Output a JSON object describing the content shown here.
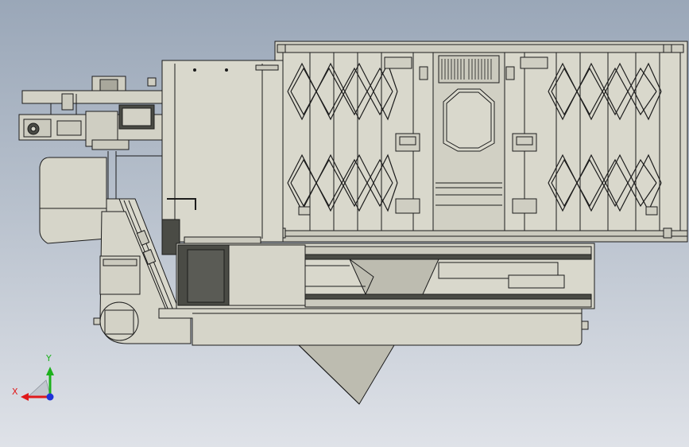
{
  "viewport": {
    "background_top": "#9aa7b8",
    "background_bottom": "#dfe2e8",
    "model_fill": "#d6d5c9",
    "model_fill_dark": "#bdbcb0",
    "model_shade": "#4a4b45",
    "model_line": "#1c1c1c"
  },
  "triad": {
    "x_label": "X",
    "y_label": "Y",
    "x_color": "#e0191b",
    "y_color": "#1db11d",
    "z_color": "#1f33d8"
  }
}
